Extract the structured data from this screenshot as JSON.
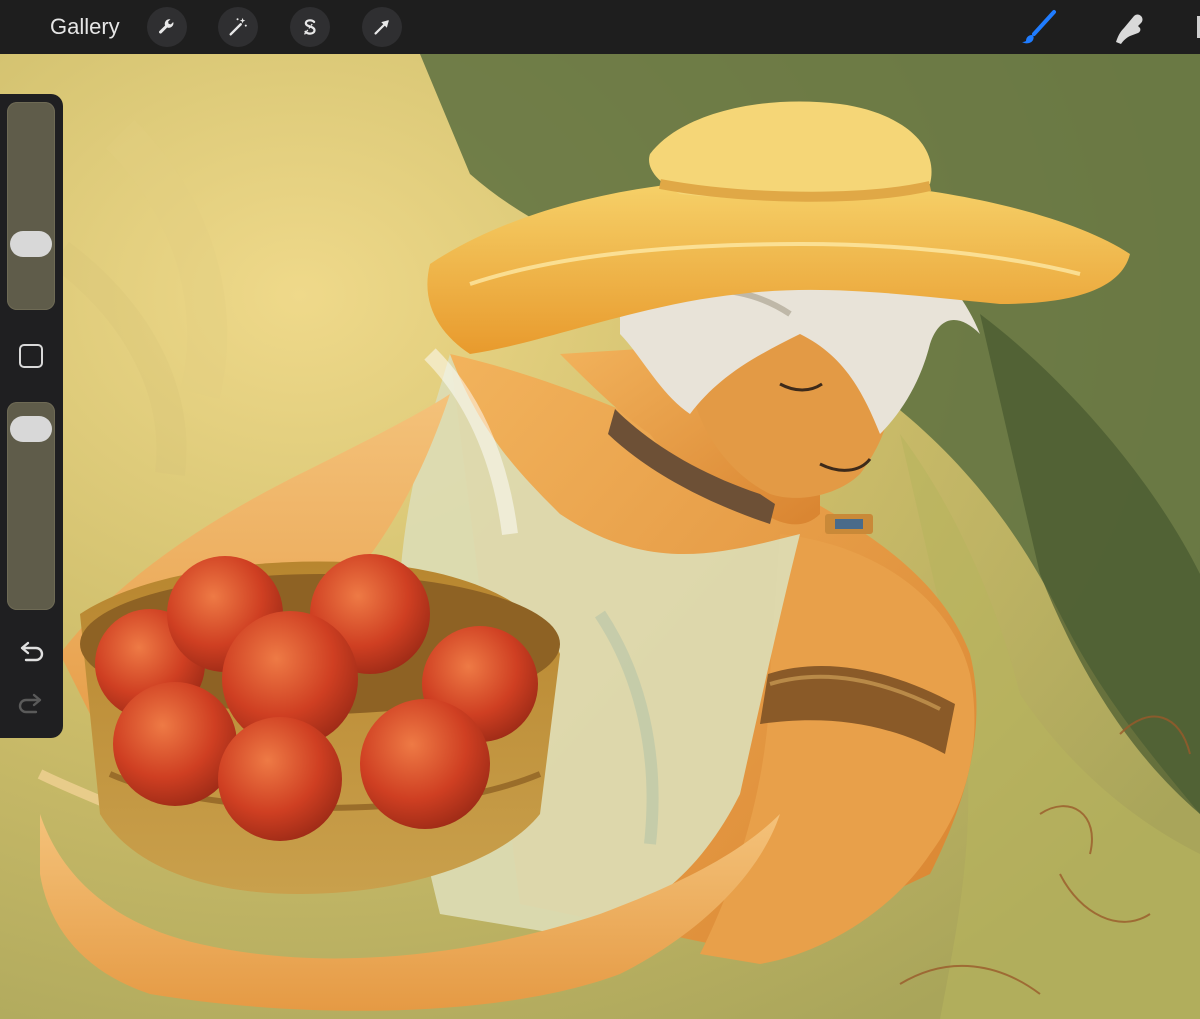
{
  "app": {
    "gallery_label": "Gallery"
  },
  "toolbar": {
    "left_tools": [
      {
        "name": "actions",
        "icon": "wrench-icon"
      },
      {
        "name": "adjustments",
        "icon": "magic-wand-icon"
      },
      {
        "name": "selection",
        "icon": "selection-s-icon"
      },
      {
        "name": "transform",
        "icon": "arrow-cursor-icon"
      }
    ],
    "right_tools": [
      {
        "name": "brush",
        "icon": "brush-icon",
        "active": true,
        "color": "#1f7cff"
      },
      {
        "name": "smudge",
        "icon": "smudge-finger-icon",
        "active": false
      }
    ]
  },
  "sidebar": {
    "brush_size": 0.28,
    "opacity": 0.94,
    "modifier_icon": "square-modifier-icon",
    "undo_icon": "undo-icon",
    "redo_icon": "redo-icon",
    "redo_enabled": false
  },
  "canvas": {
    "artwork": "painting-canvas",
    "palette": {
      "background_warm": "#d8c167",
      "foliage": "#55683a",
      "skin": "#e29a46",
      "hat": "#f2b540",
      "apples": "#c73b1f",
      "basket": "#a8742e",
      "cloth": "#dcdcb4"
    }
  }
}
